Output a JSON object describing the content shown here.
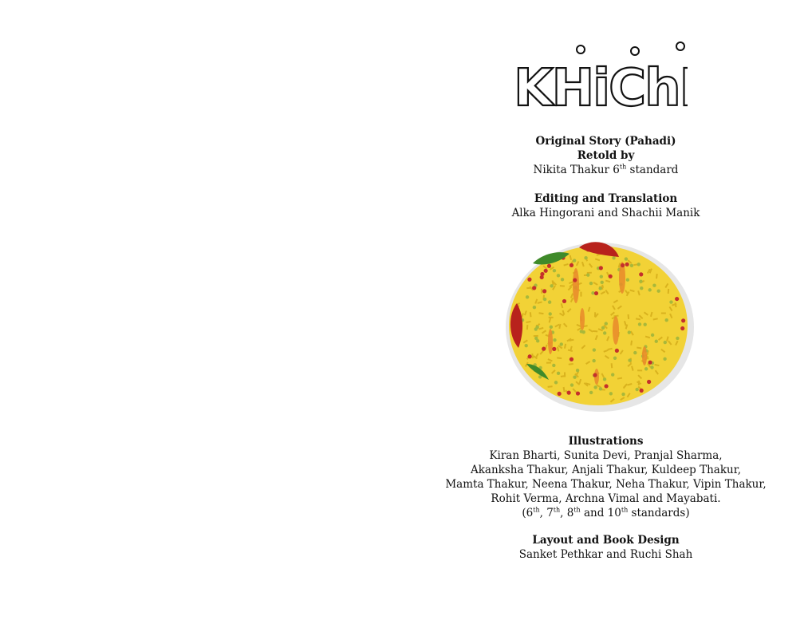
{
  "book": {
    "title": "KHiChDi",
    "original_story_heading": "Original Story (Pahadi)",
    "retold_by_heading": "Retold by",
    "retold_by_name": "Nikita Thakur 6",
    "retold_by_sup": "th",
    "retold_by_suffix": " standard",
    "editing_heading": "Editing and Translation",
    "editing_names": "Alka Hingorani and Shachii Manik",
    "illustrations_heading": "Illustrations",
    "illustrators": [
      "Kiran Bharti, Sunita Devi, Pranjal Sharma,",
      "Akanksha Thakur, Anjali Thakur, Kuldeep Thakur,",
      "Mamta Thakur, Neena Thakur, Neha Thakur, Vipin Thakur,",
      "Rohit Verma, Archna Vimal and Mayabati."
    ],
    "standards": {
      "open": "(6",
      "sup1": "th",
      "sep1": ", 7",
      "sup2": "th",
      "sep2": ", 8",
      "sup3": "th",
      "sep3": " and 10",
      "sup4": "th",
      "close": " standards)"
    },
    "layout_heading": "Layout and Book Design",
    "layout_names": "Sanket Pethkar and Ruchi Shah"
  },
  "illustration": {
    "subject": "khichdi-plate-drawing",
    "colors": {
      "rice": "#f2d236",
      "rice_dark": "#d9b21e",
      "pea": "#a8b83a",
      "dot_red": "#c4302b",
      "carrot": "#e98a2a",
      "chili_red": "#b8221c",
      "leaf_green": "#3f8a2a",
      "shadow": "#e6e6e6"
    }
  }
}
